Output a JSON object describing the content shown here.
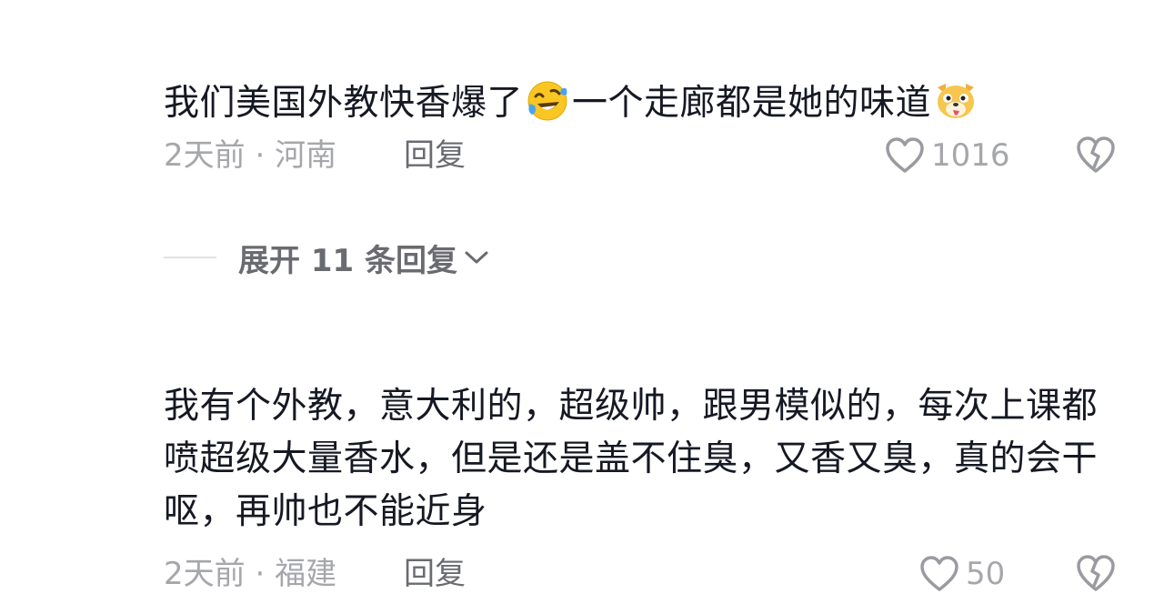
{
  "comments": [
    {
      "text_part1": "我们美国外教快香爆了",
      "emoji1": "laughing-crying-face-emoji",
      "text_part2": "一个走廊都是她的味道",
      "emoji2": "dog-tongue-out-emoji",
      "time": "2天前",
      "separator": "·",
      "location": "河南",
      "reply_label": "回复",
      "like_count": "1016",
      "expand_label": "展开 11 条回复"
    },
    {
      "text": "我有个外教，意大利的，超级帅，跟男模似的，每次上课都喷超级大量香水，但是还是盖不住臭，又香又臭，真的会干呕，再帅也不能近身",
      "time": "2天前",
      "separator": "·",
      "location": "福建",
      "reply_label": "回复",
      "like_count": "50"
    }
  ],
  "icons": {
    "like": "heart-outline-icon",
    "dislike": "broken-heart-icon",
    "expand": "chevron-down-icon"
  },
  "colors": {
    "text_primary": "#161823",
    "text_secondary": "#a6a7ab",
    "reply": "#6a6b70",
    "emoji_yellow": "#f9c623",
    "emoji_tear": "#4aa3f0"
  }
}
